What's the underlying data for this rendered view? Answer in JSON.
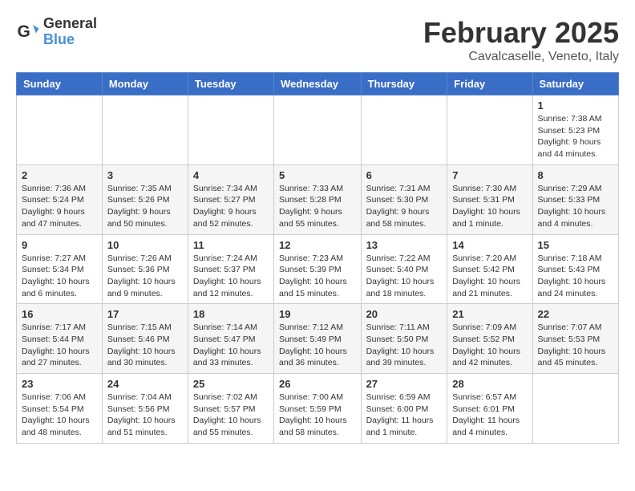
{
  "header": {
    "logo_general": "General",
    "logo_blue": "Blue",
    "month_title": "February 2025",
    "location": "Cavalcaselle, Veneto, Italy"
  },
  "days_of_week": [
    "Sunday",
    "Monday",
    "Tuesday",
    "Wednesday",
    "Thursday",
    "Friday",
    "Saturday"
  ],
  "weeks": [
    [
      {
        "day": "",
        "info": ""
      },
      {
        "day": "",
        "info": ""
      },
      {
        "day": "",
        "info": ""
      },
      {
        "day": "",
        "info": ""
      },
      {
        "day": "",
        "info": ""
      },
      {
        "day": "",
        "info": ""
      },
      {
        "day": "1",
        "info": "Sunrise: 7:38 AM\nSunset: 5:23 PM\nDaylight: 9 hours and 44 minutes."
      }
    ],
    [
      {
        "day": "2",
        "info": "Sunrise: 7:36 AM\nSunset: 5:24 PM\nDaylight: 9 hours and 47 minutes."
      },
      {
        "day": "3",
        "info": "Sunrise: 7:35 AM\nSunset: 5:26 PM\nDaylight: 9 hours and 50 minutes."
      },
      {
        "day": "4",
        "info": "Sunrise: 7:34 AM\nSunset: 5:27 PM\nDaylight: 9 hours and 52 minutes."
      },
      {
        "day": "5",
        "info": "Sunrise: 7:33 AM\nSunset: 5:28 PM\nDaylight: 9 hours and 55 minutes."
      },
      {
        "day": "6",
        "info": "Sunrise: 7:31 AM\nSunset: 5:30 PM\nDaylight: 9 hours and 58 minutes."
      },
      {
        "day": "7",
        "info": "Sunrise: 7:30 AM\nSunset: 5:31 PM\nDaylight: 10 hours and 1 minute."
      },
      {
        "day": "8",
        "info": "Sunrise: 7:29 AM\nSunset: 5:33 PM\nDaylight: 10 hours and 4 minutes."
      }
    ],
    [
      {
        "day": "9",
        "info": "Sunrise: 7:27 AM\nSunset: 5:34 PM\nDaylight: 10 hours and 6 minutes."
      },
      {
        "day": "10",
        "info": "Sunrise: 7:26 AM\nSunset: 5:36 PM\nDaylight: 10 hours and 9 minutes."
      },
      {
        "day": "11",
        "info": "Sunrise: 7:24 AM\nSunset: 5:37 PM\nDaylight: 10 hours and 12 minutes."
      },
      {
        "day": "12",
        "info": "Sunrise: 7:23 AM\nSunset: 5:39 PM\nDaylight: 10 hours and 15 minutes."
      },
      {
        "day": "13",
        "info": "Sunrise: 7:22 AM\nSunset: 5:40 PM\nDaylight: 10 hours and 18 minutes."
      },
      {
        "day": "14",
        "info": "Sunrise: 7:20 AM\nSunset: 5:42 PM\nDaylight: 10 hours and 21 minutes."
      },
      {
        "day": "15",
        "info": "Sunrise: 7:18 AM\nSunset: 5:43 PM\nDaylight: 10 hours and 24 minutes."
      }
    ],
    [
      {
        "day": "16",
        "info": "Sunrise: 7:17 AM\nSunset: 5:44 PM\nDaylight: 10 hours and 27 minutes."
      },
      {
        "day": "17",
        "info": "Sunrise: 7:15 AM\nSunset: 5:46 PM\nDaylight: 10 hours and 30 minutes."
      },
      {
        "day": "18",
        "info": "Sunrise: 7:14 AM\nSunset: 5:47 PM\nDaylight: 10 hours and 33 minutes."
      },
      {
        "day": "19",
        "info": "Sunrise: 7:12 AM\nSunset: 5:49 PM\nDaylight: 10 hours and 36 minutes."
      },
      {
        "day": "20",
        "info": "Sunrise: 7:11 AM\nSunset: 5:50 PM\nDaylight: 10 hours and 39 minutes."
      },
      {
        "day": "21",
        "info": "Sunrise: 7:09 AM\nSunset: 5:52 PM\nDaylight: 10 hours and 42 minutes."
      },
      {
        "day": "22",
        "info": "Sunrise: 7:07 AM\nSunset: 5:53 PM\nDaylight: 10 hours and 45 minutes."
      }
    ],
    [
      {
        "day": "23",
        "info": "Sunrise: 7:06 AM\nSunset: 5:54 PM\nDaylight: 10 hours and 48 minutes."
      },
      {
        "day": "24",
        "info": "Sunrise: 7:04 AM\nSunset: 5:56 PM\nDaylight: 10 hours and 51 minutes."
      },
      {
        "day": "25",
        "info": "Sunrise: 7:02 AM\nSunset: 5:57 PM\nDaylight: 10 hours and 55 minutes."
      },
      {
        "day": "26",
        "info": "Sunrise: 7:00 AM\nSunset: 5:59 PM\nDaylight: 10 hours and 58 minutes."
      },
      {
        "day": "27",
        "info": "Sunrise: 6:59 AM\nSunset: 6:00 PM\nDaylight: 11 hours and 1 minute."
      },
      {
        "day": "28",
        "info": "Sunrise: 6:57 AM\nSunset: 6:01 PM\nDaylight: 11 hours and 4 minutes."
      },
      {
        "day": "",
        "info": ""
      }
    ]
  ]
}
